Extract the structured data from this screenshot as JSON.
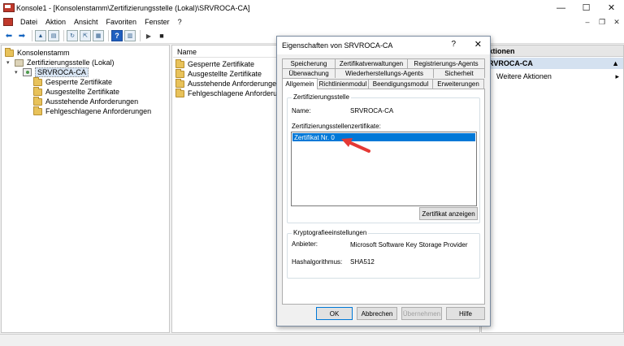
{
  "window": {
    "title": "Konsole1 - [Konsolenstamm\\Zertifizierungsstelle (Lokal)\\SRVROCA-CA]",
    "minimize": "—",
    "maximize": "☐",
    "close": "✕"
  },
  "menu": {
    "items": [
      "Datei",
      "Aktion",
      "Ansicht",
      "Favoriten",
      "Fenster",
      "?"
    ],
    "child_min": "–",
    "child_restore": "❐",
    "child_close": "✕"
  },
  "tree": {
    "root": "Konsolenstamm",
    "ca_root": "Zertifizierungsstelle (Lokal)",
    "ca_node": "SRVROCA-CA",
    "children": [
      "Gesperrte Zertifikate",
      "Ausgestellte Zertifikate",
      "Ausstehende Anforderungen",
      "Fehlgeschlagene Anforderungen"
    ]
  },
  "list": {
    "column_name": "Name",
    "items": [
      "Gesperrte Zertifikate",
      "Ausgestellte Zertifikate",
      "Ausstehende Anforderungen",
      "Fehlgeschlagene Anforderungen"
    ]
  },
  "actions": {
    "header": "Aktionen",
    "section": "SRVROCA-CA",
    "more": "Weitere Aktionen"
  },
  "dialog": {
    "title": "Eigenschaften von SRVROCA-CA",
    "help": "?",
    "close": "✕",
    "tabs_row1": [
      "Speicherung",
      "Zertifikatverwaltungen",
      "Registrierungs-Agents"
    ],
    "tabs_row2": [
      "Überwachung",
      "Wiederherstellungs-Agents",
      "Sicherheit"
    ],
    "tabs_row3": [
      "Allgemein",
      "Richtlinienmodul",
      "Beendigungsmodul",
      "Erweiterungen"
    ],
    "ca_group": "Zertifizierungsstelle",
    "name_label": "Name:",
    "name_value": "SRVROCA-CA",
    "certs_label": "Zertifizierungsstellenzertifikate:",
    "cert_item": "Zertifikat Nr. 0",
    "view_cert_button": "Zertifikat anzeigen",
    "crypto_group": "Kryptografieeinstellungen",
    "provider_label": "Anbieter:",
    "provider_value": "Microsoft Software Key Storage Provider",
    "hash_label": "Hashalgorithmus:",
    "hash_value": "SHA512",
    "ok": "OK",
    "cancel": "Abbrechen",
    "apply": "Übernehmen",
    "helpbtn": "Hilfe"
  },
  "colors": {
    "selection": "#0078d7",
    "arrow": "#e53935"
  }
}
